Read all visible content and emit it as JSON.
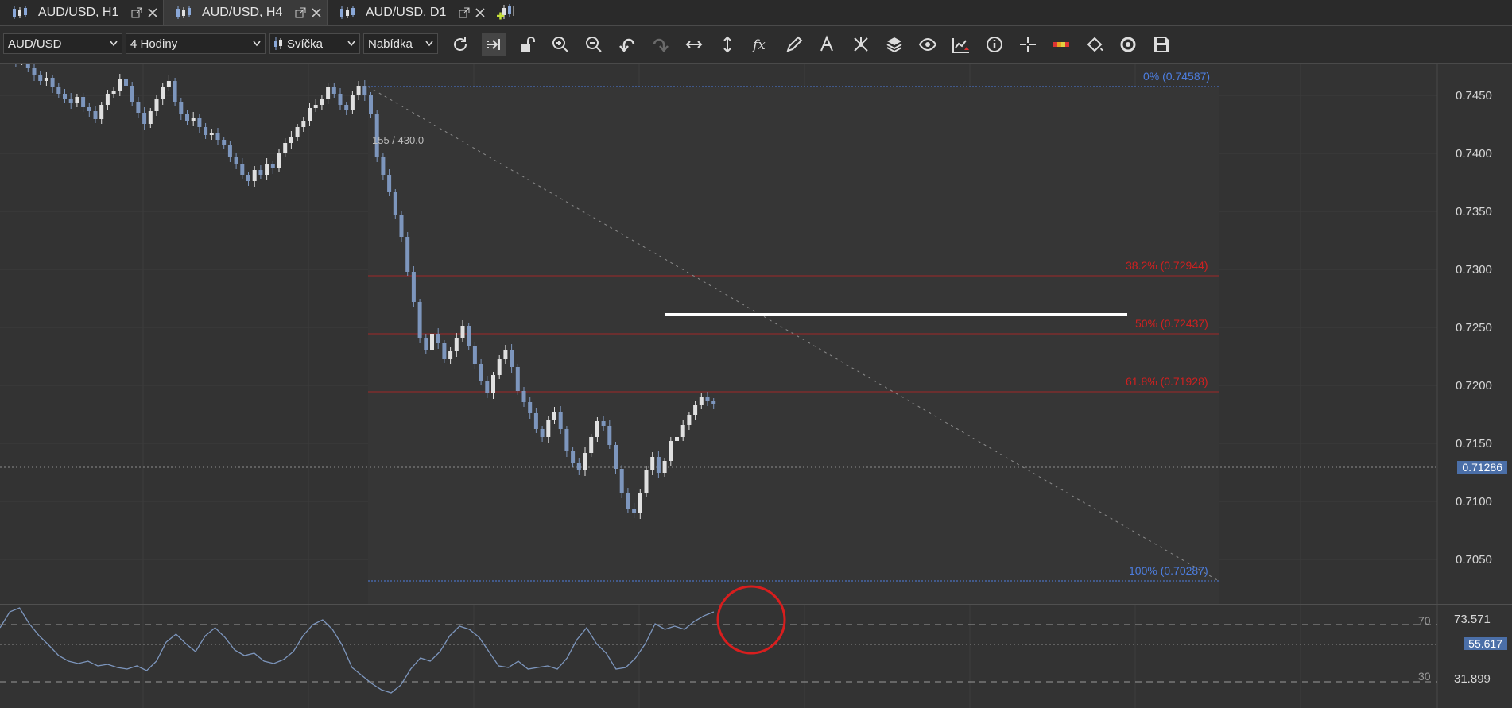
{
  "tabs": [
    {
      "label": "AUD/USD, H1",
      "active": false
    },
    {
      "label": "AUD/USD, H4",
      "active": true
    },
    {
      "label": "AUD/USD, D1",
      "active": false
    }
  ],
  "toolbar": {
    "symbol": "AUD/USD",
    "timeframe": "4 Hodiny",
    "chart_type": "Svíčka",
    "price_side": "Nabídka",
    "icons": [
      "refresh-icon",
      "auto-scroll-icon",
      "unlock-icon",
      "zoom-in-icon",
      "zoom-out-icon",
      "undo-icon",
      "redo-icon",
      "horizontal-resize-icon",
      "vertical-resize-icon",
      "function-icon",
      "pencil-icon",
      "text-icon",
      "network-icon",
      "layers-icon",
      "eye-icon",
      "indicator-icon",
      "info-icon",
      "crosshair-icon",
      "color-palette-icon",
      "fill-icon",
      "settings-icon",
      "save-icon"
    ]
  },
  "chart": {
    "ratio_label": "155 / 430.0",
    "price_axis": [
      "0.7450",
      "0.7400",
      "0.7350",
      "0.7300",
      "0.7250",
      "0.7200",
      "0.7150",
      "0.7100",
      "0.7050"
    ],
    "current_price": "0.71286",
    "fibonacci": [
      {
        "label": "0% (0.74587)",
        "color": "#4d7ee0"
      },
      {
        "label": "38.2% (0.72944)",
        "color": "#d02020"
      },
      {
        "label": "50% (0.72437)",
        "color": "#d02020"
      },
      {
        "label": "61.8% (0.71928)",
        "color": "#d02020"
      },
      {
        "label": "100% (0.70287)",
        "color": "#4d7ee0"
      }
    ]
  },
  "oscillator": {
    "level_high": "70",
    "level_low": "30",
    "axis_top": "73.571",
    "axis_bottom": "31.899",
    "current_value": "55.617"
  },
  "colors": {
    "bull_candle": "#e0e0e0",
    "bear_candle": "#7d96bd",
    "annotation_circle": "#d81e1e",
    "current_price_box": "#4b6fa8"
  }
}
